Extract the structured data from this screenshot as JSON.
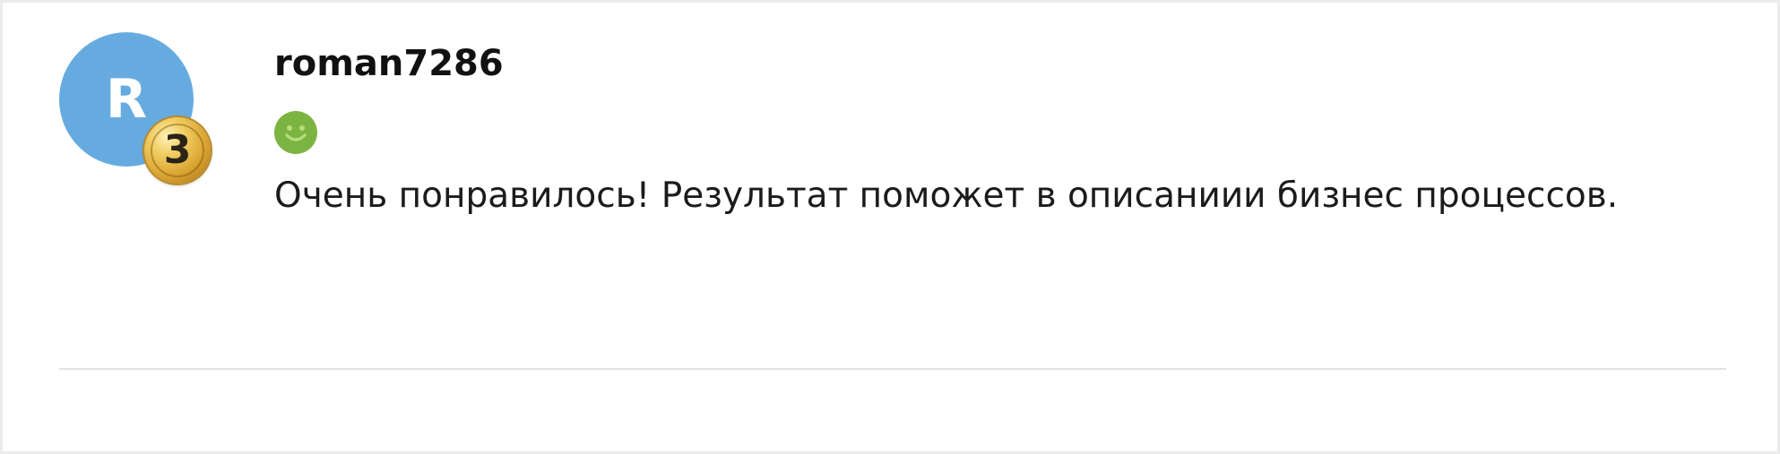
{
  "comment": {
    "avatar_letter": "R",
    "avatar_color": "#66abe0",
    "level": "3",
    "level_badge_color": "#d9a22f",
    "username": "roman7286",
    "mood_icon": "smiley-face-icon",
    "mood_color": "#7cb442",
    "text": "Очень понравилось! Результат поможет в описаниии бизнес процессов."
  }
}
